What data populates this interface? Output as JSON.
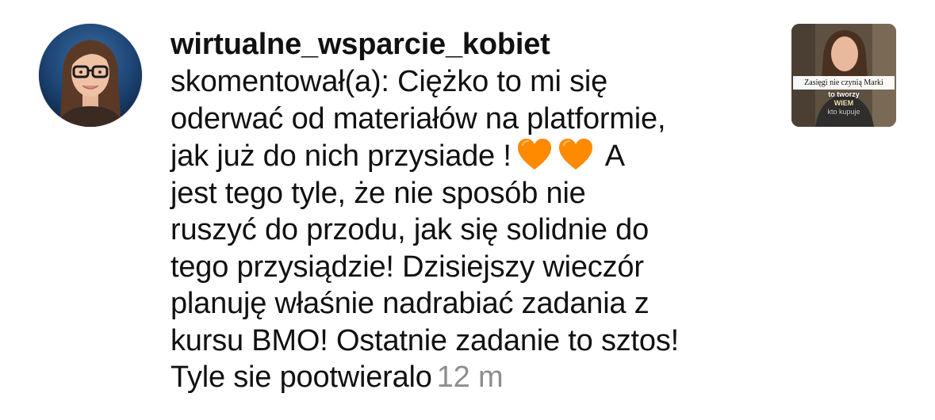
{
  "notification": {
    "username": "wirtualne_wsparcie_kobiet",
    "comment_lines": [
      "skomentował(a): Ciężko to mi się",
      "oderwać od materiałów na platformie,",
      "jak już do nich przysiade !",
      "jest tego tyle, że nie sposób nie",
      "ruszyć do przodu, jak się solidnie do",
      "tego przysiądzie! Dzisiejszy wieczór",
      "planuję właśnie nadrabiać zadania z",
      "kursu BMO! Ostatnie zadanie to sztos!",
      "Tyle sie pootwieralo"
    ],
    "after_hearts_text": "A",
    "emoji": [
      "orange-heart",
      "orange-heart"
    ],
    "timestamp": "12 m",
    "thumbnail": {
      "caption": "Zasięgi nie czynią Marki",
      "overlay_line_1": "to tworzy",
      "overlay_line_2": "WIEM",
      "overlay_line_3": "kto kupuje"
    }
  },
  "colors": {
    "text": "#111111",
    "timestamp": "#8e8e8e",
    "heart": "#ff8a00"
  }
}
